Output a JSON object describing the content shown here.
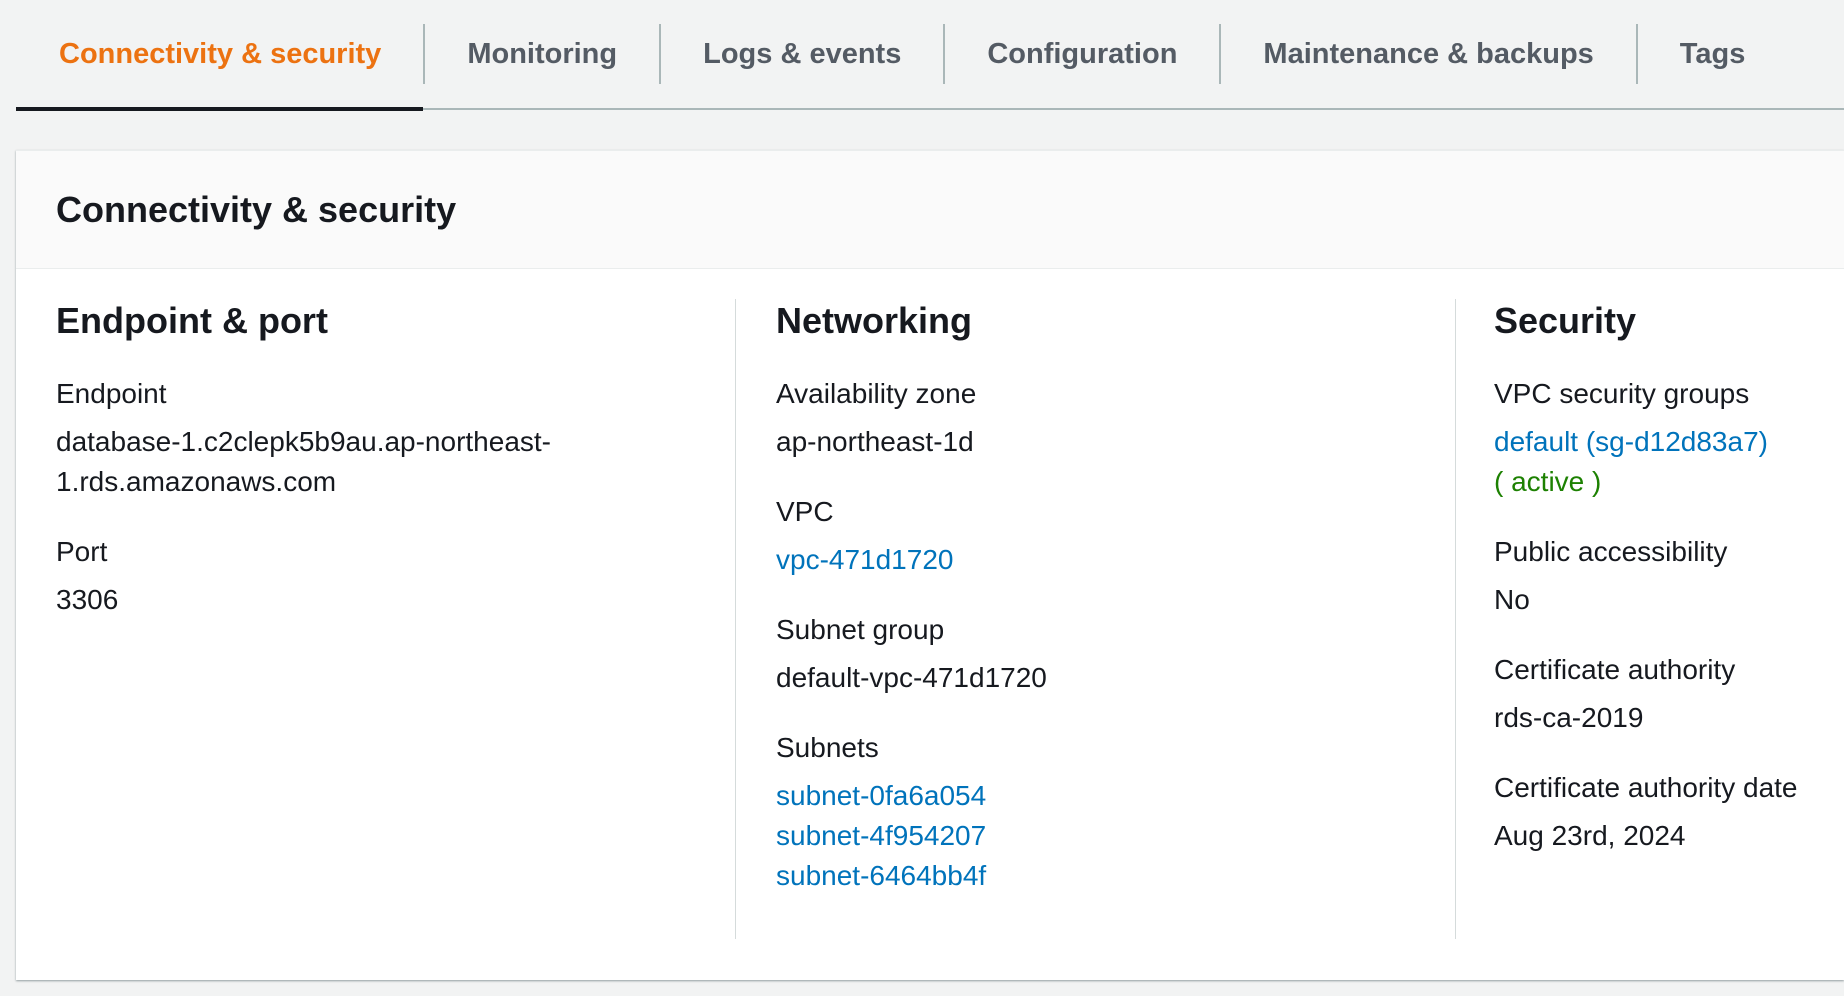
{
  "tabs": [
    {
      "label": "Connectivity & security",
      "active": true
    },
    {
      "label": "Monitoring",
      "active": false
    },
    {
      "label": "Logs & events",
      "active": false
    },
    {
      "label": "Configuration",
      "active": false
    },
    {
      "label": "Maintenance & backups",
      "active": false
    },
    {
      "label": "Tags",
      "active": false
    }
  ],
  "panel": {
    "title": "Connectivity & security",
    "endpoint_port": {
      "title": "Endpoint & port",
      "endpoint_label": "Endpoint",
      "endpoint_value_line1": "database-1.c2clepk5b9au.ap-northeast-",
      "endpoint_value_line2": "1.rds.amazonaws.com",
      "port_label": "Port",
      "port_value": "3306"
    },
    "networking": {
      "title": "Networking",
      "az_label": "Availability zone",
      "az_value": "ap-northeast-1d",
      "vpc_label": "VPC",
      "vpc_value": "vpc-471d1720",
      "subnet_group_label": "Subnet group",
      "subnet_group_value": "default-vpc-471d1720",
      "subnets_label": "Subnets",
      "subnets": [
        "subnet-0fa6a054",
        "subnet-4f954207",
        "subnet-6464bb4f"
      ]
    },
    "security": {
      "title": "Security",
      "sg_label": "VPC security groups",
      "sg_value": "default (sg-d12d83a7)",
      "sg_status": "( active )",
      "public_label": "Public accessibility",
      "public_value": "No",
      "ca_label": "Certificate authority",
      "ca_value": "rds-ca-2019",
      "ca_date_label": "Certificate authority date",
      "ca_date_value": "Aug 23rd, 2024"
    }
  },
  "colors": {
    "active_tab": "#ec7211",
    "link": "#0073bb",
    "status_active": "#1d8102"
  }
}
